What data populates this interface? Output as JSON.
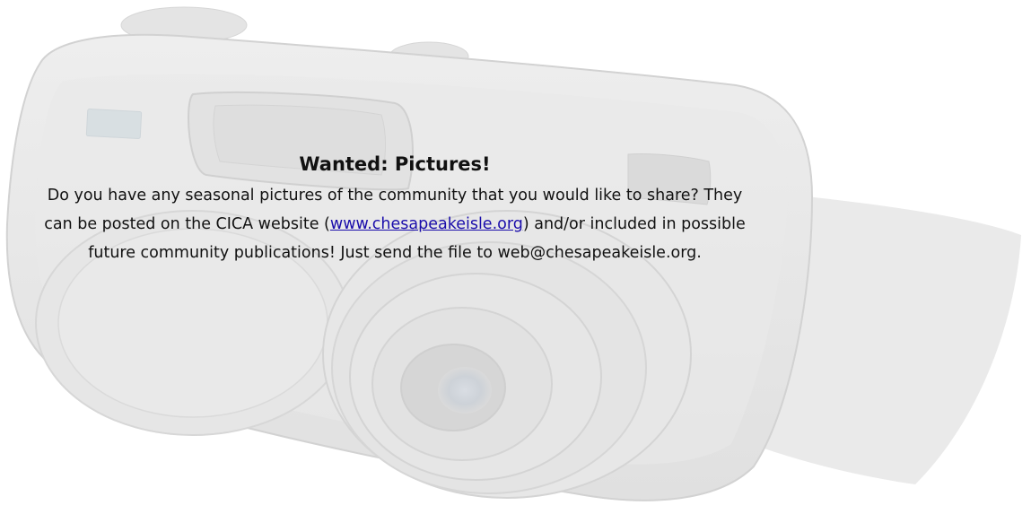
{
  "notice": {
    "title": "Wanted:  Pictures!",
    "body_before_link": "Do you have any seasonal pictures of the community that you would like to share?  They can be posted on the CICA website (",
    "link_text": "www.chesapeakeisle.org",
    "body_after_link": ") and/or included in possible future community publications!  Just send the file to web@chesapeakeisle.org."
  },
  "colors": {
    "text": "#111111",
    "link": "#1a0dab",
    "camera_body": "#e6e6e6",
    "camera_shadow": "#ececec",
    "camera_outline": "#d2d2d2"
  },
  "background_image": {
    "icon": "camera-icon"
  }
}
